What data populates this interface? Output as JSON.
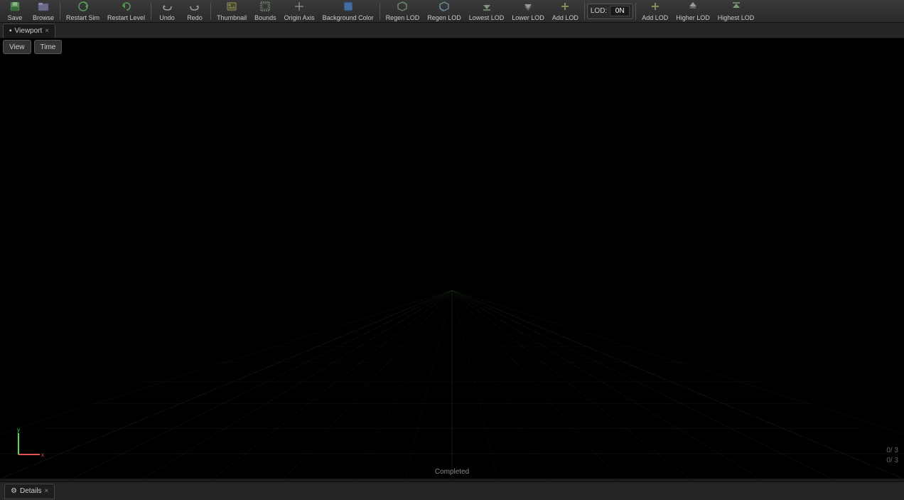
{
  "toolbar": {
    "buttons": [
      {
        "id": "save",
        "label": "Save",
        "icon": "💾"
      },
      {
        "id": "browse",
        "label": "Browse",
        "icon": "📁"
      },
      {
        "id": "restart-sim",
        "label": "Restart Sim",
        "icon": "▶"
      },
      {
        "id": "restart-level",
        "label": "Restart Level",
        "icon": "🔄"
      },
      {
        "id": "undo",
        "label": "Undo",
        "icon": "↩"
      },
      {
        "id": "redo",
        "label": "Redo",
        "icon": "↪"
      },
      {
        "id": "thumbnail",
        "label": "Thumbnail",
        "icon": "🖼"
      },
      {
        "id": "bounds",
        "label": "Bounds",
        "icon": "⬜"
      },
      {
        "id": "origin-axis",
        "label": "Origin Axis",
        "icon": "✛"
      },
      {
        "id": "background-color",
        "label": "Background Color",
        "icon": "🎨"
      },
      {
        "id": "regen-lod",
        "label": "Regen LOD",
        "icon": "🔁"
      },
      {
        "id": "regen-lod2",
        "label": "Regen LOD",
        "icon": "🔃"
      },
      {
        "id": "lowest-lod",
        "label": "Lowest LOD",
        "icon": "⬇"
      },
      {
        "id": "lower-lod",
        "label": "Lower LOD",
        "icon": "↓"
      },
      {
        "id": "add-lod",
        "label": "Add LOD",
        "icon": "➕"
      }
    ],
    "lod_label": "LOD:",
    "lod_value": "0",
    "lod_suffix": "N",
    "add_lod_label": "Add LOD",
    "higher_lod_label": "Higher LOD",
    "highest_lod_label": "Highest LOD"
  },
  "viewport_tab": {
    "icon": "▪",
    "label": "Viewport",
    "close": "×"
  },
  "view_buttons": [
    {
      "id": "view",
      "label": "View"
    },
    {
      "id": "time",
      "label": "Time"
    }
  ],
  "status": {
    "completed": "Completed"
  },
  "coords": {
    "line1": "0/ 3",
    "line2": "0/ 3"
  },
  "bottom_panel": {
    "tab_icon": "⚙",
    "tab_label": "Details",
    "tab_close": "×"
  },
  "grid": {
    "color": "#1a2a1a",
    "line_color": "#1e3a1e"
  },
  "colors": {
    "toolbar_bg": "#2e2e2e",
    "viewport_bg": "#000000",
    "tab_bg": "#1a1a1a",
    "panel_bg": "#252525",
    "accent": "#4a7a4a"
  }
}
